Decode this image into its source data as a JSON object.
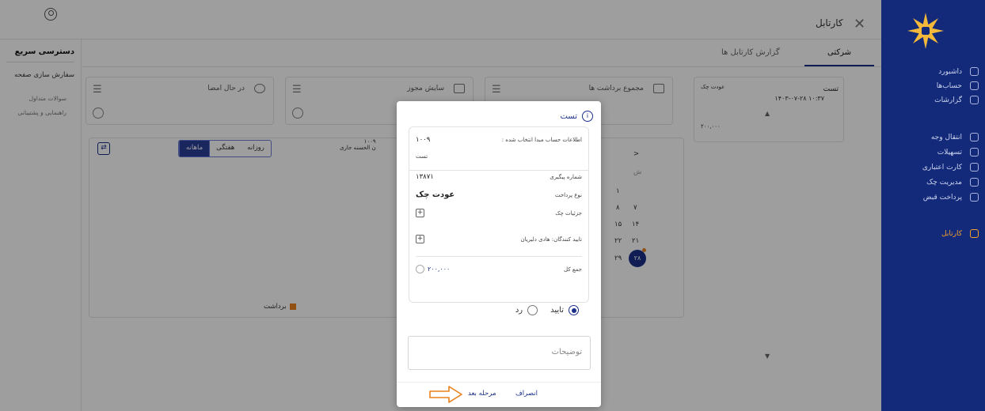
{
  "topbar": {
    "title": "کارتابل"
  },
  "quick_access": {
    "title": "دسترسی سریع",
    "items": [
      "سفارش سازی صفحه",
      "سوالات متداول",
      "راهنمایی و پشتیبانی"
    ]
  },
  "tabs": [
    {
      "label": "شرکتی"
    },
    {
      "label": "گزارش کارتابل ها"
    }
  ],
  "stats": [
    {
      "label": "مجموع برداشت ها"
    },
    {
      "label": "سایش مجوز"
    },
    {
      "label": "در حال امضا"
    }
  ],
  "check_card": {
    "title": "تست",
    "date": "۱۴۰۳-۰۷-۲۸ ۱۰:۳۷",
    "type": "عودت چک",
    "amount": "۲۰۰,۰۰۰"
  },
  "chart": {
    "toggles": [
      "روزانه",
      "هفتگی",
      "ماهانه"
    ],
    "active_toggle": "ماهانه",
    "account_number": "۱۰۰۹",
    "account_name": "ن الحسنه جاری",
    "legend": "برداشت",
    "legend_color": "#e8811c"
  },
  "calendar": {
    "header_arrow": ">",
    "weekday": "ش",
    "days": [
      {
        "t": "۱"
      },
      {
        "t": "۸"
      },
      {
        "t": "۷"
      },
      {
        "t": "۱۵"
      },
      {
        "t": "۱۴"
      },
      {
        "t": "۲۲"
      },
      {
        "t": "۲۱"
      },
      {
        "t": "۲۹"
      }
    ],
    "today": "۲۸"
  },
  "sidebar": {
    "items": [
      {
        "label": "داشبورد",
        "icon": "dashboard-icon"
      },
      {
        "label": "حساب‌ها",
        "icon": "bank-icon"
      },
      {
        "label": "گزارشات",
        "icon": "report-icon"
      },
      {
        "label": "انتقال وجه",
        "icon": "transfer-icon"
      },
      {
        "label": "تسهیلات",
        "icon": "loan-icon"
      },
      {
        "label": "کارت اعتباری",
        "icon": "card-icon"
      },
      {
        "label": "مدیریت چک",
        "icon": "cheque-icon"
      },
      {
        "label": "پرداخت قبض",
        "icon": "bill-icon"
      },
      {
        "label": "کارتابل",
        "icon": "cartable-icon"
      }
    ],
    "active": "کارتابل"
  },
  "modal": {
    "title": "تست",
    "account_label": "اطلاعات حساب مبدا انتخاب شده :",
    "account_number": "۱۰۰۹",
    "account_name": "تست",
    "tracking_label": "شماره پیگیری",
    "tracking_value": "۱۳۸۷۱",
    "payment_type_label": "نوع پرداخت",
    "payment_type_value": "عودت چک",
    "check_details_label": "جزئیات چک",
    "approvers_label": "تایید کنندگان: هادی دلیریان",
    "total_label": "جمع کل",
    "total_value": "۲۰۰,۰۰۰",
    "approve_label": "تایید",
    "reject_label": "رد",
    "description_placeholder": "توضیحات",
    "cancel_label": "انصراف",
    "next_label": "مرحله بعد",
    "accent": "#1a2f8a"
  }
}
